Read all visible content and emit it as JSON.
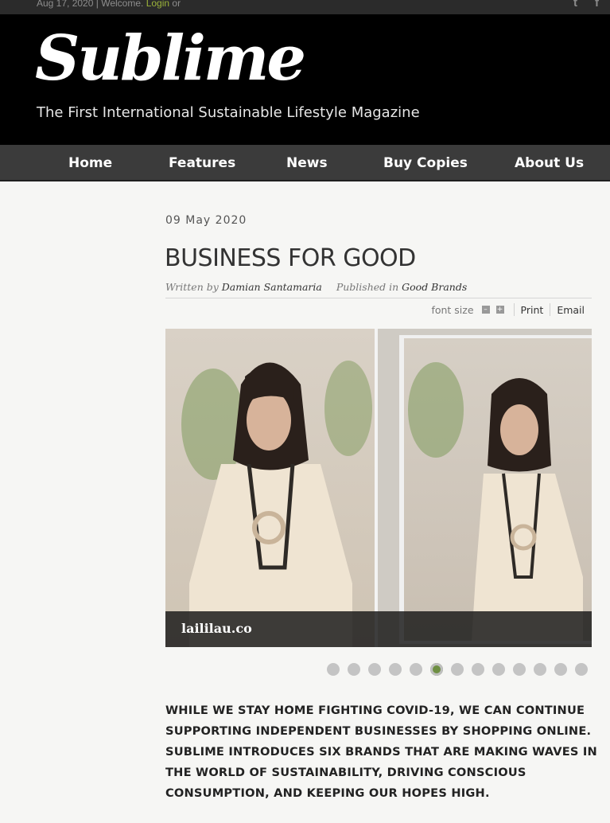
{
  "topbar": {
    "date": "Aug 17, 2020",
    "separator": "|",
    "welcome": "Welcome.",
    "login": "Login",
    "or": "or",
    "social": [
      "twitter-icon",
      "facebook-icon"
    ],
    "twitter_glyph": "t",
    "facebook_glyph": "f"
  },
  "header": {
    "logo": "Sublime",
    "tagline": "The First International Sustainable Lifestyle Magazine"
  },
  "nav": {
    "items": [
      {
        "label": "Home"
      },
      {
        "label": "Features"
      },
      {
        "label": "News"
      },
      {
        "label": "Buy Copies"
      },
      {
        "label": "About Us"
      }
    ]
  },
  "article": {
    "date": "09 May 2020",
    "title": "BUSINESS FOR GOOD",
    "written_by_label": "Written by",
    "author": "Damian Santamaria",
    "published_in_label": "Published in",
    "category": "Good Brands",
    "tools": {
      "font_size_label": "font size",
      "decrease": "–",
      "increase": "+",
      "print": "Print",
      "email": "Email"
    },
    "gallery": {
      "caption": "laililau.co",
      "slide_count": 13,
      "active_slide": 6
    },
    "lead": "WHILE WE STAY HOME FIGHTING COVID-19, WE CAN CONTINUE SUPPORTING INDEPENDENT BUSINESSES BY SHOPPING ONLINE. SUBLIME INTRODUCES SIX BRANDS THAT ARE MAKING WAVES IN THE WORLD OF SUSTAINABILITY, DRIVING CONSCIOUS CONSUMPTION, AND KEEPING OUR HOPES HIGH."
  },
  "colors": {
    "accent": "#9bb33a",
    "active_dot": "#6e8f42",
    "nav_bg": "#3b3b3b",
    "masthead_bg": "#000000"
  }
}
